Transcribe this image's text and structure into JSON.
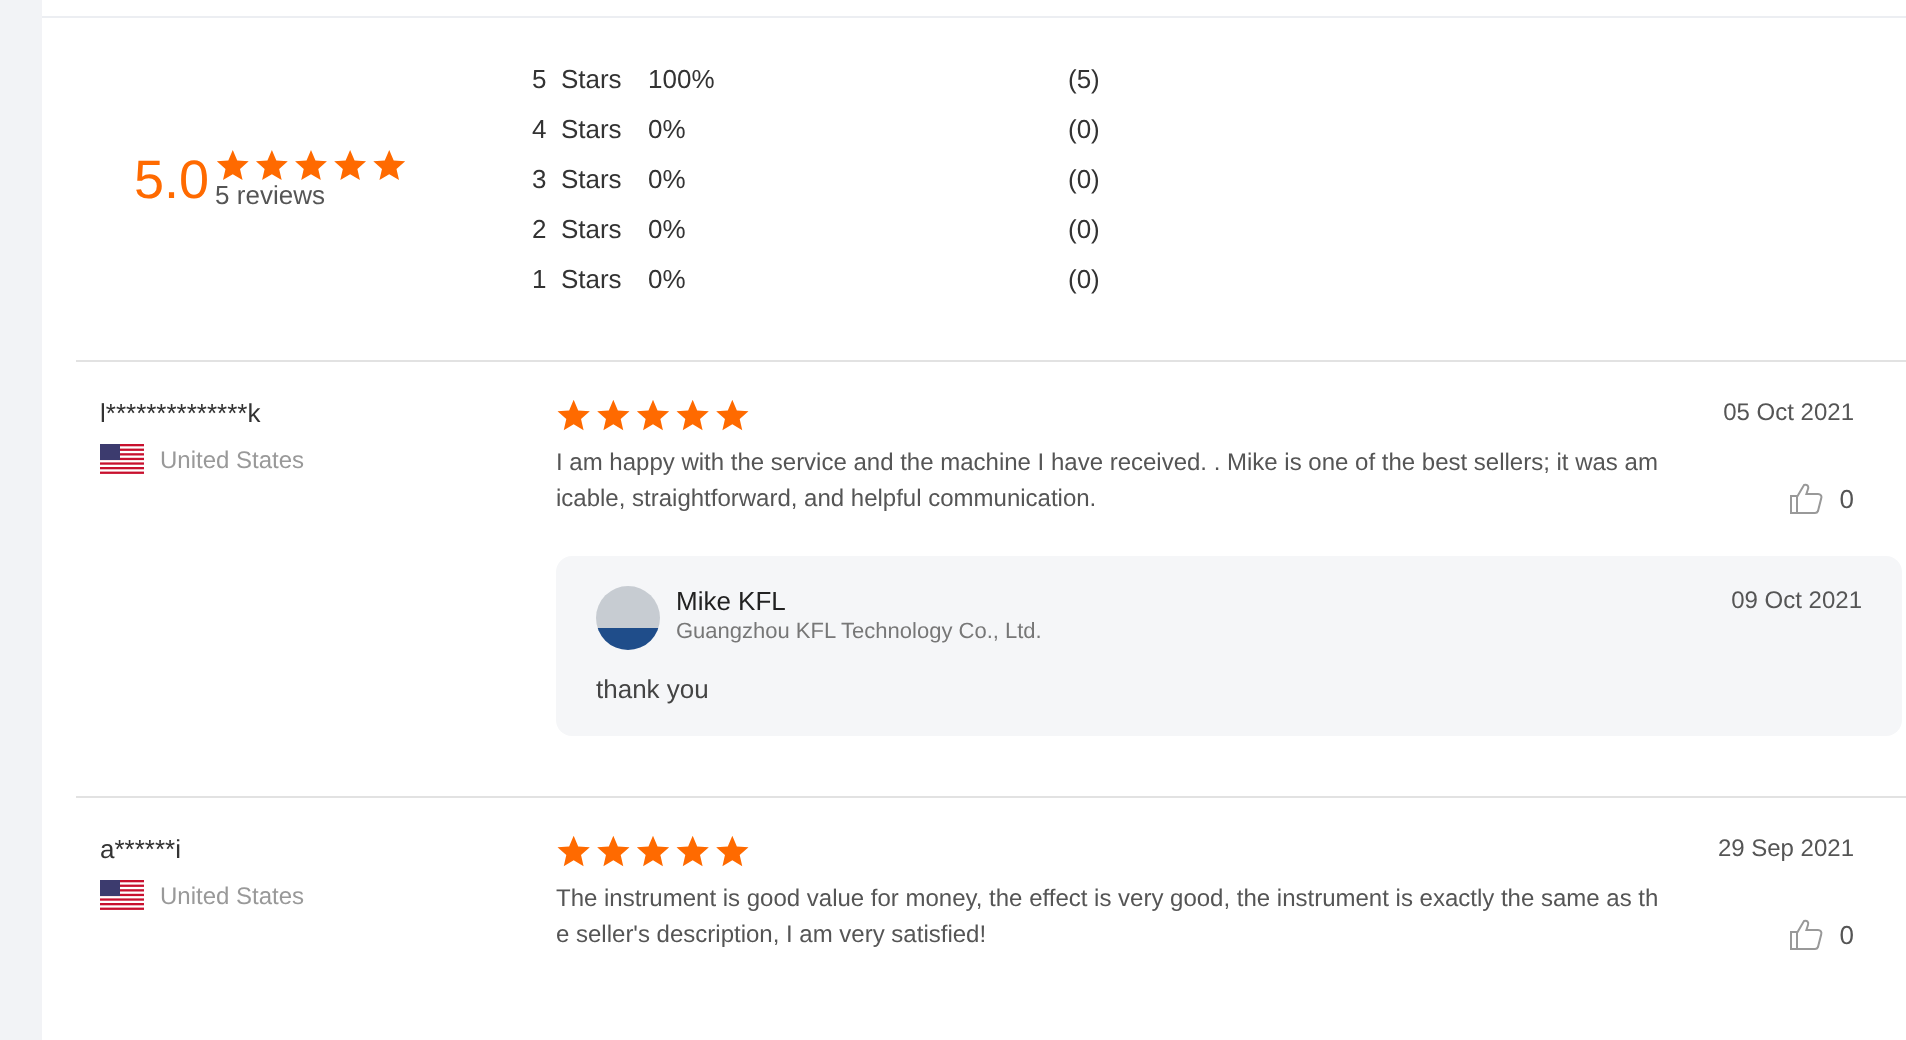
{
  "summary": {
    "score": "5.0",
    "stars": 5,
    "review_count": "5 reviews",
    "distribution": [
      {
        "label": "5  Stars",
        "percent": "100%",
        "count": "(5)"
      },
      {
        "label": "4  Stars",
        "percent": "0%",
        "count": "(0)"
      },
      {
        "label": "3  Stars",
        "percent": "0%",
        "count": "(0)"
      },
      {
        "label": "2  Stars",
        "percent": "0%",
        "count": "(0)"
      },
      {
        "label": "1  Stars",
        "percent": "0%",
        "count": "(0)"
      }
    ]
  },
  "reviews": [
    {
      "reviewer": "l**************k",
      "country": "United States",
      "stars": 5,
      "date": "05 Oct 2021",
      "text": "I am happy with the service and the machine I have received. . Mike is one of the best sellers; it was amicable, straightforward, and helpful communication.",
      "likes": "0",
      "reply": {
        "name": "Mike KFL",
        "company": "Guangzhou KFL Technology Co., Ltd.",
        "date": "09 Oct 2021",
        "text": "thank you"
      }
    },
    {
      "reviewer": "a******i",
      "country": "United States",
      "stars": 5,
      "date": "29 Sep 2021",
      "text": "The instrument is good value for money, the effect is very good, the instrument is exactly the same as the seller's description, I am very satisfied!",
      "likes": "0"
    }
  ]
}
